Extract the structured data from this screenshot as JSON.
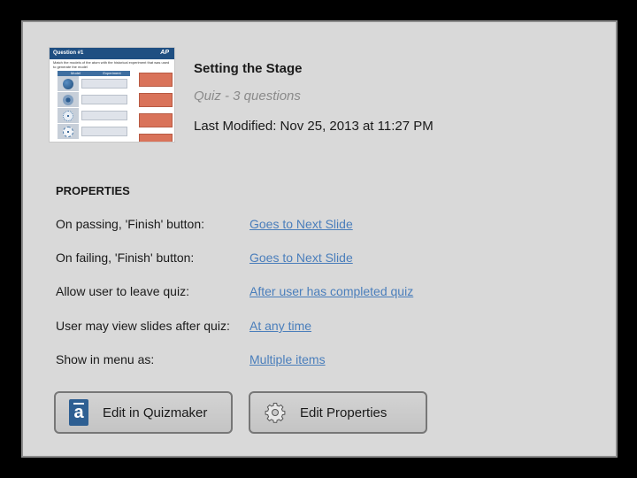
{
  "quiz": {
    "title": "Setting the Stage",
    "subtitle": "Quiz - 3 questions",
    "last_modified": "Last Modified: Nov 25, 2013 at 11:27 PM"
  },
  "thumbnail": {
    "header": "Question #1",
    "logo": "AP",
    "instructions": "Match the models of the atom with the historical experiment that was used to generate the model",
    "columns": [
      "Model",
      "Experiment"
    ],
    "atom_colors": [
      "#2c5d8f",
      "#3b6ea5",
      "#8aa6c4",
      "#b6c6d8"
    ]
  },
  "properties": {
    "heading": "PROPERTIES",
    "rows": [
      {
        "label": "On passing, 'Finish' button:",
        "value": "Goes to Next Slide"
      },
      {
        "label": "On failing, 'Finish' button:",
        "value": "Goes to Next Slide"
      },
      {
        "label": "Allow user to leave quiz:",
        "value": "After user has completed quiz"
      },
      {
        "label": "User may view slides after quiz:",
        "value": "At any time"
      },
      {
        "label": "Show in menu as:",
        "value": "Multiple items"
      }
    ]
  },
  "buttons": {
    "edit_quizmaker": "Edit in Quizmaker",
    "edit_properties": "Edit Properties",
    "quizmaker_icon": "a"
  },
  "colors": {
    "panel_bg": "#d9d9d9",
    "link": "#4a7ebb",
    "thumb_header": "#1f4f82"
  }
}
